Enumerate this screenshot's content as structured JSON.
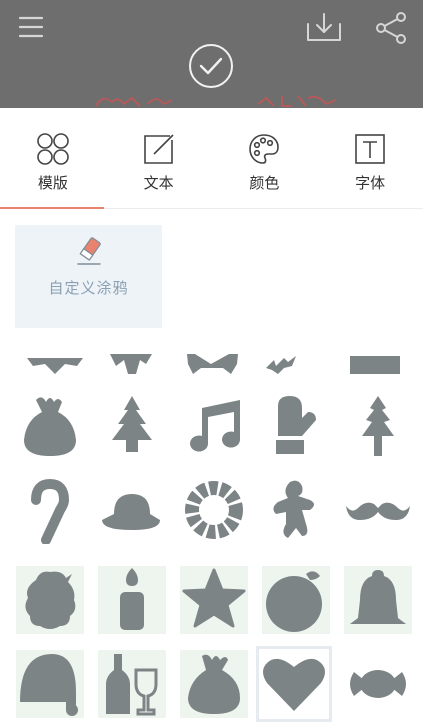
{
  "toolbar": {
    "icons": [
      "menu-icon",
      "download-icon",
      "share-icon",
      "confirm-check-icon"
    ]
  },
  "tabs": [
    {
      "label": "模版",
      "icon": "template-grid-icon",
      "active": true
    },
    {
      "label": "文本",
      "icon": "text-edit-icon",
      "active": false
    },
    {
      "label": "颜色",
      "icon": "palette-icon",
      "active": false
    },
    {
      "label": "字体",
      "icon": "font-icon",
      "active": false
    }
  ],
  "custom": {
    "label": "自定义涂鸦",
    "icon": "eraser-icon"
  },
  "stickers": [
    "bow-partial",
    "ribbon-partial",
    "mustache-partial",
    "tree-partial",
    "bar-partial",
    "gift-sack-icon",
    "christmas-tree-icon",
    "music-note-icon",
    "mitten-icon",
    "pine-tree-icon",
    "candy-cane-icon",
    "hat-icon",
    "wreath-icon",
    "gingerbread-man-icon",
    "mustache-icon",
    "santa-beard-icon",
    "candle-icon",
    "star-icon",
    "ornament-ball-icon",
    "bell-icon",
    "santa-hat-icon",
    "wine-bottle-glass-icon",
    "sack-icon",
    "heart-icon",
    "candy-icon"
  ],
  "colors": {
    "accent": "#e9836f",
    "sticker": "#7d8485",
    "preview_bg": "#6e6e6e"
  }
}
